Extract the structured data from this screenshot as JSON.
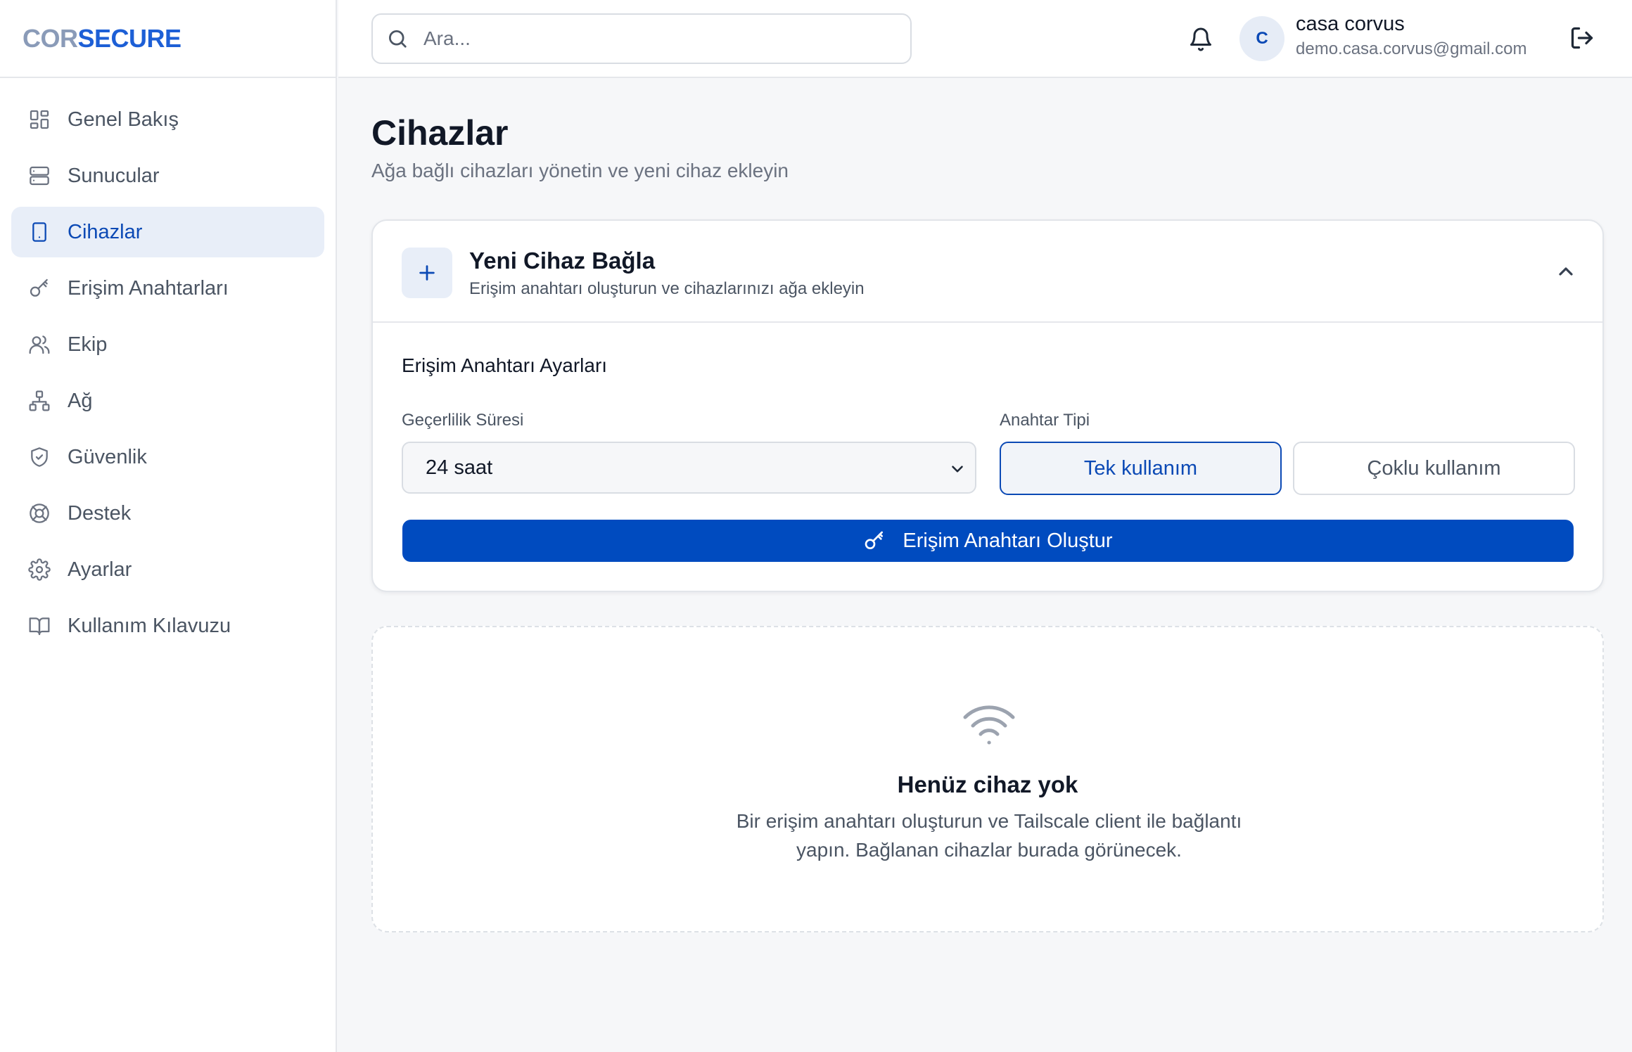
{
  "brand": {
    "part1": "COR",
    "part2": "SECURE"
  },
  "sidebar": {
    "items": [
      {
        "label": "Genel Bakış",
        "icon": "dashboard-icon"
      },
      {
        "label": "Sunucular",
        "icon": "server-icon"
      },
      {
        "label": "Cihazlar",
        "icon": "device-icon",
        "active": true
      },
      {
        "label": "Erişim Anahtarları",
        "icon": "key-icon"
      },
      {
        "label": "Ekip",
        "icon": "users-icon"
      },
      {
        "label": "Ağ",
        "icon": "network-icon"
      },
      {
        "label": "Güvenlik",
        "icon": "shield-icon"
      },
      {
        "label": "Destek",
        "icon": "lifebuoy-icon"
      },
      {
        "label": "Ayarlar",
        "icon": "gear-icon"
      },
      {
        "label": "Kullanım Kılavuzu",
        "icon": "book-icon"
      }
    ]
  },
  "header": {
    "search_placeholder": "Ara...",
    "avatar_initial": "C",
    "user_name": "casa corvus",
    "user_email": "demo.casa.corvus@gmail.com"
  },
  "page": {
    "title": "Cihazlar",
    "subtitle": "Ağa bağlı cihazları yönetin ve yeni cihaz ekleyin"
  },
  "connect_card": {
    "title": "Yeni Cihaz Bağla",
    "description": "Erişim anahtarı oluşturun ve cihazlarınızı ağa ekleyin",
    "section_title": "Erişim Anahtarı Ayarları",
    "validity_label": "Geçerlilik Süresi",
    "validity_value": "24 saat",
    "key_type_label": "Anahtar Tipi",
    "key_type_options": [
      "Tek kullanım",
      "Çoklu kullanım"
    ],
    "key_type_selected": "Tek kullanım",
    "create_button": "Erişim Anahtarı Oluştur"
  },
  "empty_state": {
    "icon": "wifi-icon",
    "title": "Henüz cihaz yok",
    "description": "Bir erişim anahtarı oluşturun ve Tailscale client ile bağlantı yapın. Bağlanan cihazlar burada görünecek."
  },
  "colors": {
    "accent": "#004bbf",
    "active_bg": "#e8eef8",
    "logo_muted": "#8a9bb8",
    "logo_accent": "#1d5fd6"
  }
}
